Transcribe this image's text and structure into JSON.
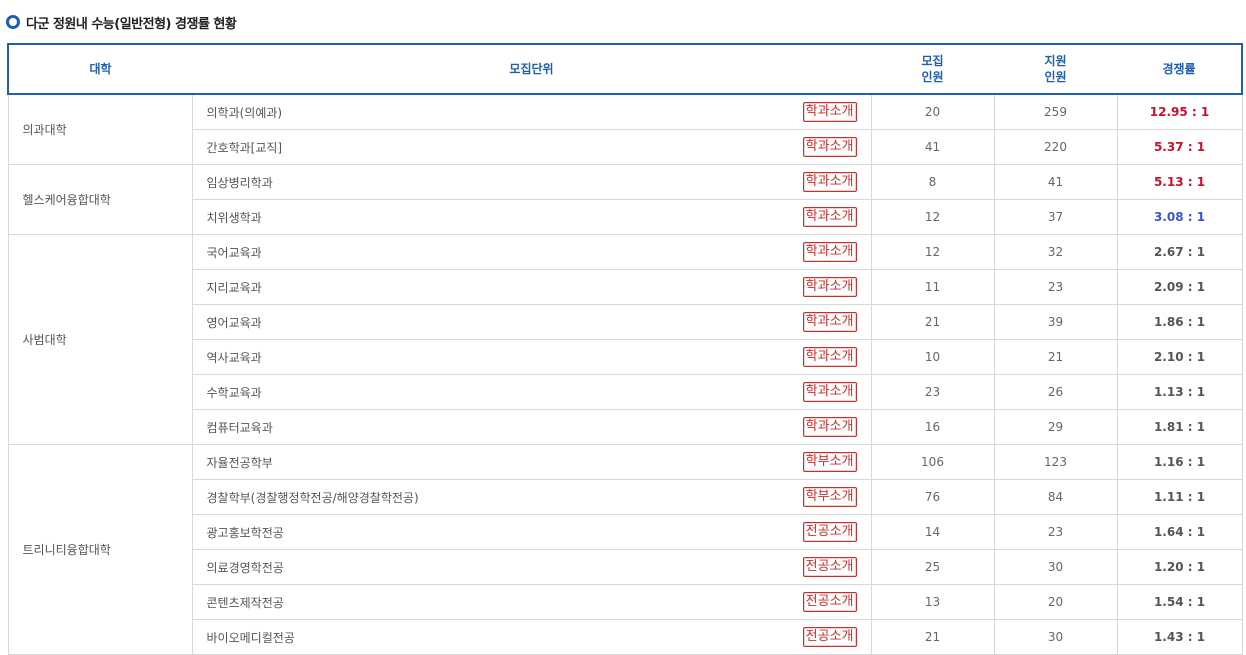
{
  "title": "다군 정원내 수능(일반전형) 경쟁률 현황",
  "headers": {
    "college": "대학",
    "dept": "모집단위",
    "quota_1": "모집",
    "quota_2": "인원",
    "applicants_1": "지원",
    "applicants_2": "인원",
    "ratio": "경쟁률"
  },
  "colors": {
    "accent": "#1f5fae",
    "high_ratio": "#c8102e",
    "mid_ratio": "#3a55c9",
    "button": "#c9302c"
  },
  "groups": [
    {
      "college": "의과대학",
      "rows": [
        {
          "dept": "의학과(의예과)",
          "button": "학과소개",
          "quota": "20",
          "applicants": "259",
          "ratio": "12.95 : 1",
          "tone": "red"
        },
        {
          "dept": "간호학과[교직]",
          "button": "학과소개",
          "quota": "41",
          "applicants": "220",
          "ratio": "5.37 : 1",
          "tone": "red"
        }
      ]
    },
    {
      "college": "헬스케어융합대학",
      "rows": [
        {
          "dept": "임상병리학과",
          "button": "학과소개",
          "quota": "8",
          "applicants": "41",
          "ratio": "5.13 : 1",
          "tone": "red"
        },
        {
          "dept": "치위생학과",
          "button": "학과소개",
          "quota": "12",
          "applicants": "37",
          "ratio": "3.08 : 1",
          "tone": "blue"
        }
      ]
    },
    {
      "college": "사범대학",
      "rows": [
        {
          "dept": "국어교육과",
          "button": "학과소개",
          "quota": "12",
          "applicants": "32",
          "ratio": "2.67 : 1",
          "tone": ""
        },
        {
          "dept": "지리교육과",
          "button": "학과소개",
          "quota": "11",
          "applicants": "23",
          "ratio": "2.09 : 1",
          "tone": ""
        },
        {
          "dept": "영어교육과",
          "button": "학과소개",
          "quota": "21",
          "applicants": "39",
          "ratio": "1.86 : 1",
          "tone": ""
        },
        {
          "dept": "역사교육과",
          "button": "학과소개",
          "quota": "10",
          "applicants": "21",
          "ratio": "2.10 : 1",
          "tone": ""
        },
        {
          "dept": "수학교육과",
          "button": "학과소개",
          "quota": "23",
          "applicants": "26",
          "ratio": "1.13 : 1",
          "tone": ""
        },
        {
          "dept": "컴퓨터교육과",
          "button": "학과소개",
          "quota": "16",
          "applicants": "29",
          "ratio": "1.81 : 1",
          "tone": ""
        }
      ]
    },
    {
      "college": "트리니티융합대학",
      "rows": [
        {
          "dept": "자율전공학부",
          "button": "학부소개",
          "quota": "106",
          "applicants": "123",
          "ratio": "1.16 : 1",
          "tone": ""
        },
        {
          "dept": "경찰학부(경찰행정학전공/해양경찰학전공)",
          "button": "학부소개",
          "quota": "76",
          "applicants": "84",
          "ratio": "1.11 : 1",
          "tone": ""
        },
        {
          "dept": "광고홍보학전공",
          "button": "전공소개",
          "quota": "14",
          "applicants": "23",
          "ratio": "1.64 : 1",
          "tone": ""
        },
        {
          "dept": "의료경영학전공",
          "button": "전공소개",
          "quota": "25",
          "applicants": "30",
          "ratio": "1.20 : 1",
          "tone": ""
        },
        {
          "dept": "콘텐츠제작전공",
          "button": "전공소개",
          "quota": "13",
          "applicants": "20",
          "ratio": "1.54 : 1",
          "tone": ""
        },
        {
          "dept": "바이오메디컬전공",
          "button": "전공소개",
          "quota": "21",
          "applicants": "30",
          "ratio": "1.43 : 1",
          "tone": ""
        }
      ]
    }
  ]
}
